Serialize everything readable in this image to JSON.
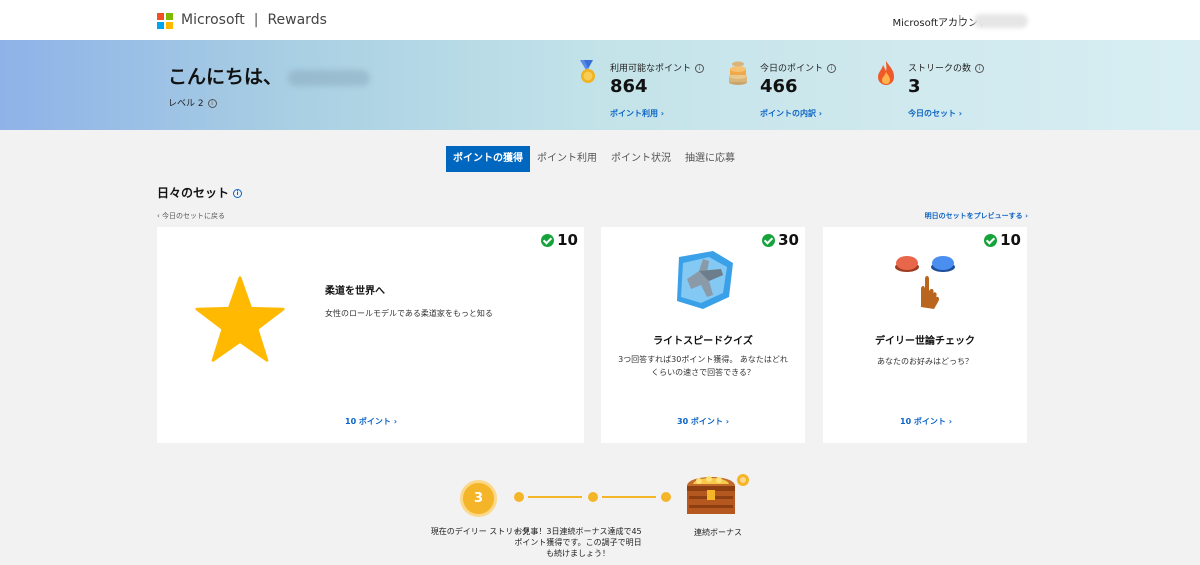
{
  "header": {
    "brand": "Microsoft",
    "separator": "|",
    "product": "Rewards",
    "account_label": "Microsoftアカウント",
    "account_separator": "|"
  },
  "hero": {
    "greeting": "こんにちは、",
    "level": "レベル 2",
    "stats": [
      {
        "label": "利用可能なポイント",
        "value": "864",
        "link": "ポイント利用 ›",
        "icon": "medal-icon"
      },
      {
        "label": "今日のポイント",
        "value": "466",
        "link": "ポイントの内訳 ›",
        "icon": "coins-icon"
      },
      {
        "label": "ストリークの数",
        "value": "3",
        "link": "今日のセット ›",
        "icon": "flame-icon"
      }
    ]
  },
  "tabs": [
    {
      "label": "ポイントの獲得",
      "active": true
    },
    {
      "label": "ポイント利用",
      "active": false
    },
    {
      "label": "ポイント状況",
      "active": false
    },
    {
      "label": "抽選に応募",
      "active": false
    }
  ],
  "daily_set": {
    "title": "日々のセット",
    "back_link": "‹ 今日のセットに戻る",
    "preview_link": "明日のセットをプレビューする ›",
    "cards": [
      {
        "points": "10",
        "title": "柔道を世界へ",
        "description": "女性のロールモデルである柔道家をもっと知る",
        "link": "10 ポイント ›",
        "icon": "star-icon"
      },
      {
        "points": "30",
        "title": "ライトスピードクイズ",
        "description": "3つ回答すれば30ポイント獲得。 あなたはどれくらいの速さで回答できる？",
        "link": "30 ポイント ›",
        "icon": "jet-icon"
      },
      {
        "points": "10",
        "title": "デイリー世論チェック",
        "description": "あなたのお好みはどっち？",
        "link": "10 ポイント ›",
        "icon": "poll-buttons-icon"
      }
    ]
  },
  "streak": {
    "count": "3",
    "current_label": "現在のデイリー ストリーク",
    "message": "お見事！3日連続ボーナス達成で45ポイント獲得です。この調子で明日も続けましょう！",
    "bonus_label": "連続ボーナス"
  },
  "colors": {
    "accent": "#0067c0",
    "link": "#0b63c5",
    "streak": "#f5b528",
    "check": "#16a33c",
    "star": "#ffb900"
  }
}
